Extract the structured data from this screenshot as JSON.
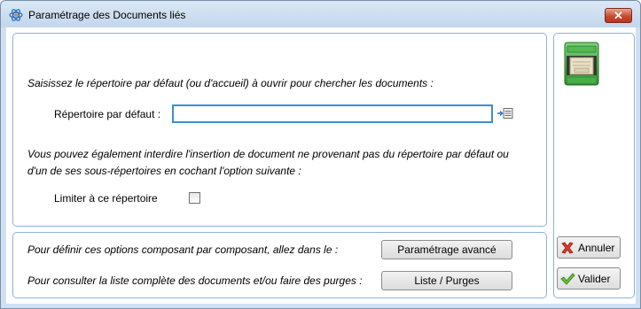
{
  "window": {
    "title": "Paramétrage des Documents liés",
    "close_label": "✕"
  },
  "main": {
    "intro_text": "Saisissez le répertoire par défaut (ou d'accueil) à ouvrir pour chercher les documents :",
    "dir_label": "Répertoire par défaut :",
    "dir_value": "",
    "restrict_text_line1": "Vous pouvez également interdire l'insertion de document ne provenant pas du répertoire par défaut ou",
    "restrict_text_line2": "d'un de ses sous-répertoires en cochant l'option suivante :",
    "limit_label": "Limiter à ce répertoire",
    "limit_checked": false
  },
  "bottom": {
    "options_text": "Pour définir ces options composant par composant, allez dans le :",
    "advanced_button": "Paramétrage avancé",
    "list_text": "Pour consulter la liste complète des documents et/ou faire des purges :",
    "list_button": "Liste / Purges"
  },
  "side": {
    "cancel_label": "Annuler",
    "validate_label": "Valider"
  },
  "icons": {
    "app": "atom-icon",
    "browse": "browse-folder-icon",
    "cabinet": "file-cabinet-icon",
    "cancel": "red-x-icon",
    "validate": "green-check-icon"
  },
  "colors": {
    "title_bar": "#c9dbef",
    "close_button": "#c94a31",
    "input_focus_border": "#3a8fd0",
    "panel_border": "#8fb2d8",
    "cabinet_green": "#3aa53a"
  }
}
